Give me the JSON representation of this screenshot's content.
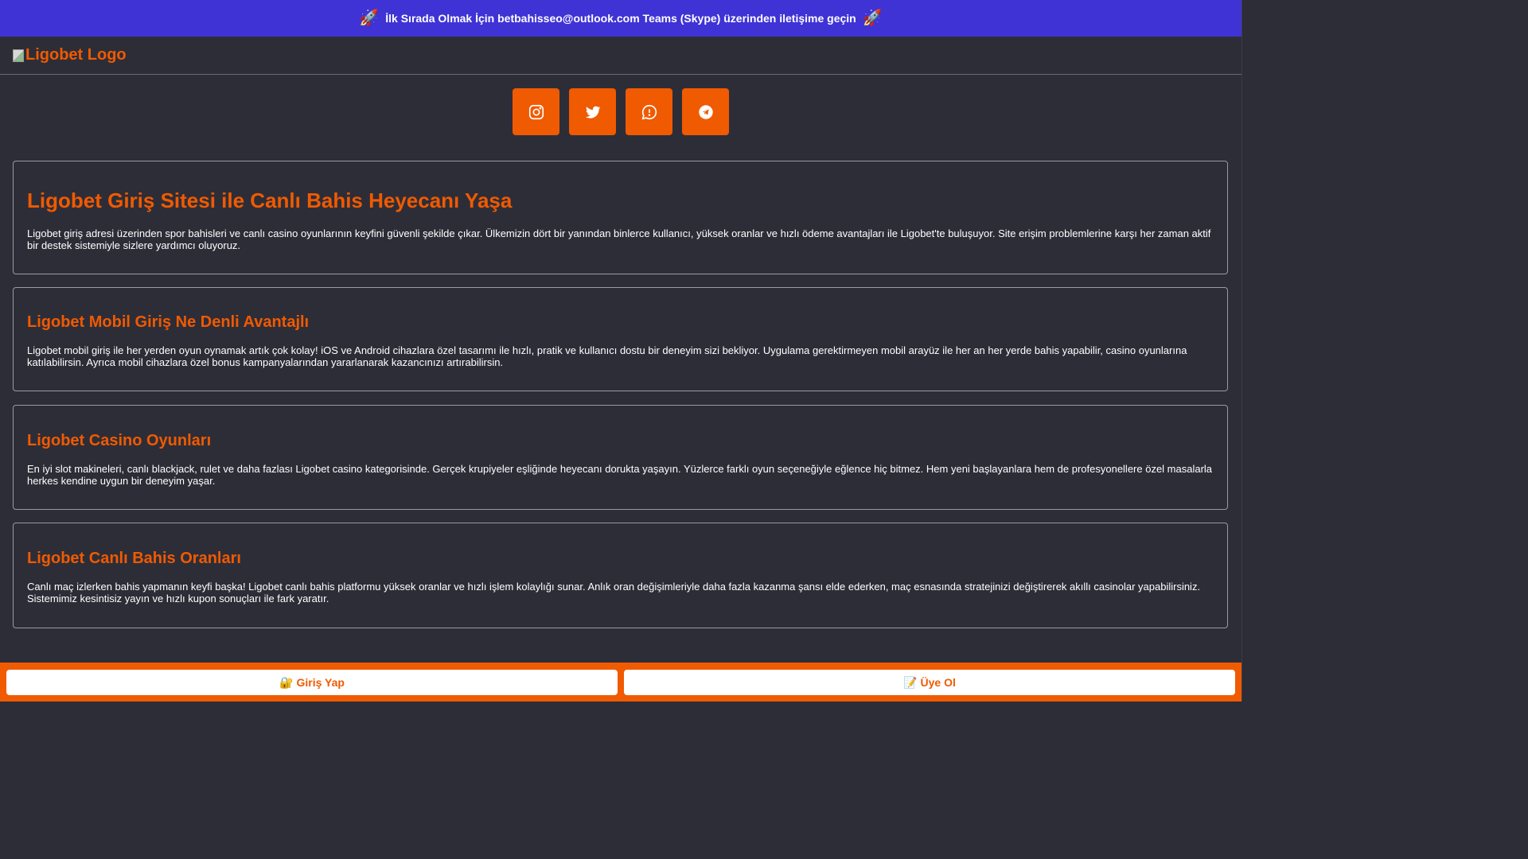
{
  "banner": {
    "text": "İlk Sırada Olmak İçin betbahisseo@outlook.com Teams (Skype) üzerinden iletişime geçin",
    "left_icon": "🚀",
    "right_icon": "🚀",
    "background": "#3f33d6"
  },
  "header": {
    "logo_alt": "Ligobet Logo"
  },
  "social": {
    "items": [
      {
        "name": "instagram-icon"
      },
      {
        "name": "twitter-icon"
      },
      {
        "name": "whatsapp-icon"
      },
      {
        "name": "telegram-icon"
      }
    ],
    "color": "#f05a00"
  },
  "sections": [
    {
      "title": "Ligobet Giriş Sitesi ile Canlı Bahis Heyecanı Yaşa",
      "body": "Ligobet giriş adresi üzerinden spor bahisleri ve canlı casino oyunlarının keyfini güvenli şekilde çıkar. Ülkemizin dört bir yanından binlerce kullanıcı, yüksek oranlar ve hızlı ödeme avantajları ile Ligobet'te buluşuyor. Site erişim problemlerine karşı her zaman aktif bir destek sistemiyle sizlere yardımcı oluyoruz."
    },
    {
      "title": "Ligobet Mobil Giriş Ne Denli Avantajlı",
      "body": "Ligobet mobil giriş ile her yerden oyun oynamak artık çok kolay! iOS ve Android cihazlara özel tasarımı ile hızlı, pratik ve kullanıcı dostu bir deneyim sizi bekliyor. Uygulama gerektirmeyen mobil arayüz ile her an her yerde bahis yapabilir, casino oyunlarına katılabilirsin. Ayrıca mobil cihazlara özel bonus kampanyalarından yararlanarak kazancınızı artırabilirsin."
    },
    {
      "title": "Ligobet Casino Oyunları",
      "body": "En iyi slot makineleri, canlı blackjack, rulet ve daha fazlası Ligobet casino kategorisinde. Gerçek krupiyeler eşliğinde heyecanı dorukta yaşayın. Yüzlerce farklı oyun seçeneğiyle eğlence hiç bitmez. Hem yeni başlayanlara hem de profesyonellere özel masalarla herkes kendine uygun bir deneyim yaşar."
    },
    {
      "title": "Ligobet Canlı Bahis Oranları",
      "body": "Canlı maç izlerken bahis yapmanın keyfi başka! Ligobet canlı bahis platformu yüksek oranlar ve hızlı işlem kolaylığı sunar. Anlık oran değişimleriyle daha fazla kazanma şansı elde ederken, maç esnasında stratejinizi değiştirerek akıllı casinolar yapabilirsiniz. Sistemimiz kesintisiz yayın ve hızlı kupon sonuçları ile fark yaratır."
    }
  ],
  "bottom_bar": {
    "login_icon": "🔐",
    "login_label": "Giriş Yap",
    "register_icon": "📝",
    "register_label": "Üye Ol"
  },
  "colors": {
    "accent": "#f05a00",
    "background": "#2d2d38"
  }
}
